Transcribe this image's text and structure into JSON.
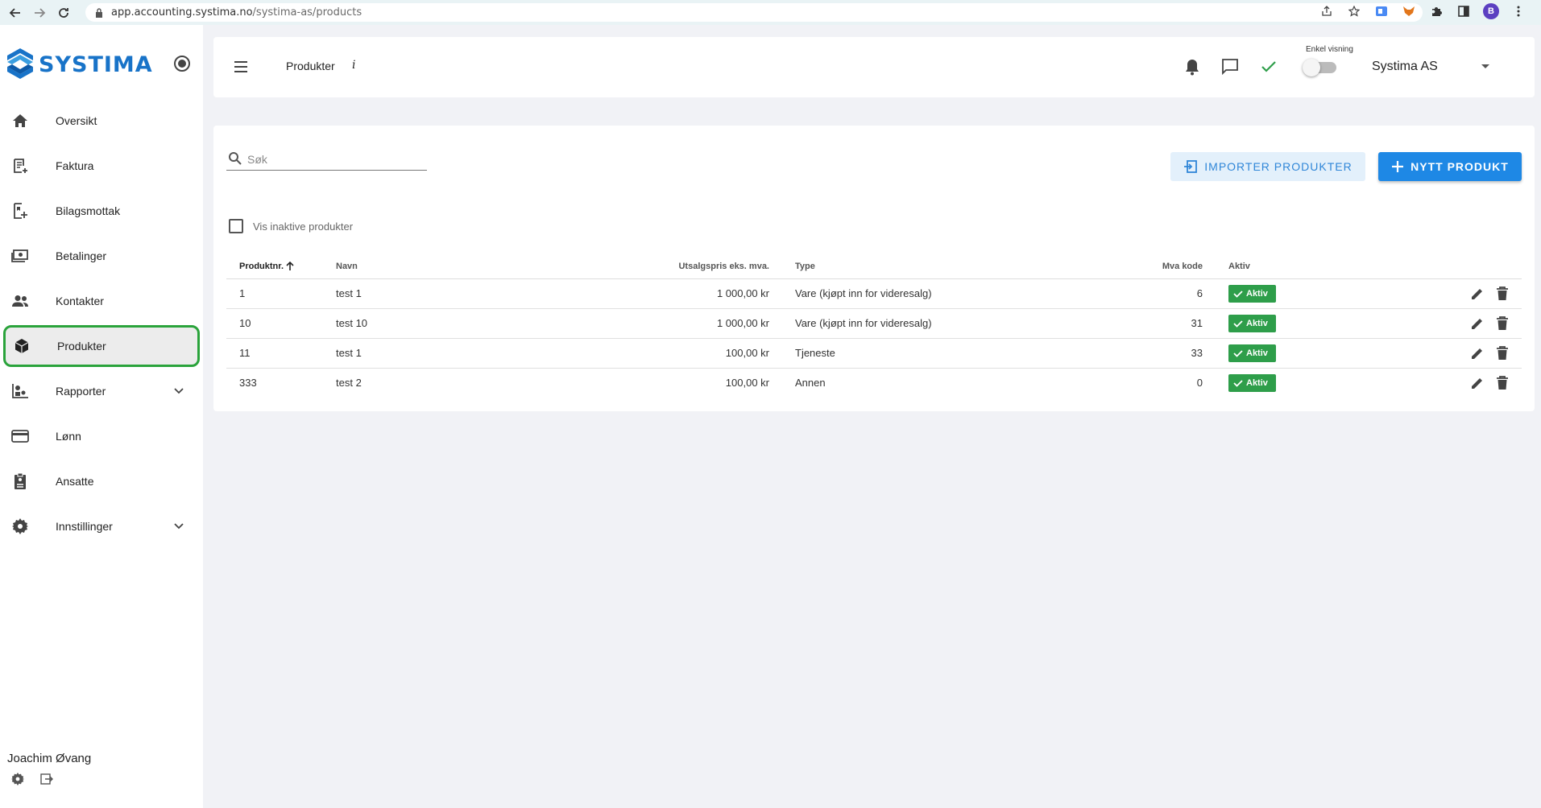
{
  "browser": {
    "url_domain": "app.accounting.systima.no",
    "url_path": "/systima-as/products",
    "profile_initial": "B"
  },
  "sidebar": {
    "brand": "SYSTIMA",
    "items": [
      {
        "label": "Oversikt",
        "icon": "home-icon"
      },
      {
        "label": "Faktura",
        "icon": "invoice-icon"
      },
      {
        "label": "Bilagsmottak",
        "icon": "receipt-inbox-icon"
      },
      {
        "label": "Betalinger",
        "icon": "payments-icon"
      },
      {
        "label": "Kontakter",
        "icon": "contacts-icon"
      },
      {
        "label": "Produkter",
        "icon": "box-icon",
        "active": true
      },
      {
        "label": "Rapporter",
        "icon": "reports-icon",
        "expandable": true
      },
      {
        "label": "Lønn",
        "icon": "card-icon"
      },
      {
        "label": "Ansatte",
        "icon": "badge-icon"
      },
      {
        "label": "Innstillinger",
        "icon": "gear-icon",
        "expandable": true
      }
    ],
    "user_name": "Joachim Øvang"
  },
  "topbar": {
    "page_title": "Produkter",
    "info": "i",
    "toggle_label": "Enkel visning",
    "company": "Systima AS"
  },
  "toolbar": {
    "search_placeholder": "Søk",
    "import_label": "IMPORTER PRODUKTER",
    "new_label": "NYTT PRODUKT",
    "inactive_checkbox_label": "Vis inaktive produkter"
  },
  "table": {
    "columns": [
      "Produktnr.",
      "Navn",
      "Utsalgspris eks. mva.",
      "Type",
      "Mva kode",
      "Aktiv"
    ],
    "rows": [
      {
        "nr": "1",
        "name": "test 1",
        "price": "1 000,00 kr",
        "type": "Vare (kjøpt inn for videresalg)",
        "mva": "6",
        "status": "Aktiv"
      },
      {
        "nr": "10",
        "name": "test 10",
        "price": "1 000,00 kr",
        "type": "Vare (kjøpt inn for videresalg)",
        "mva": "31",
        "status": "Aktiv"
      },
      {
        "nr": "11",
        "name": "test 1",
        "price": "100,00 kr",
        "type": "Tjeneste",
        "mva": "33",
        "status": "Aktiv"
      },
      {
        "nr": "333",
        "name": "test 2",
        "price": "100,00 kr",
        "type": "Annen",
        "mva": "0",
        "status": "Aktiv"
      }
    ]
  },
  "colors": {
    "brand_blue": "#1873c8",
    "primary_button": "#1e88e5",
    "active_badge": "#2e9e4a",
    "highlight_ring": "#2aa33b"
  }
}
